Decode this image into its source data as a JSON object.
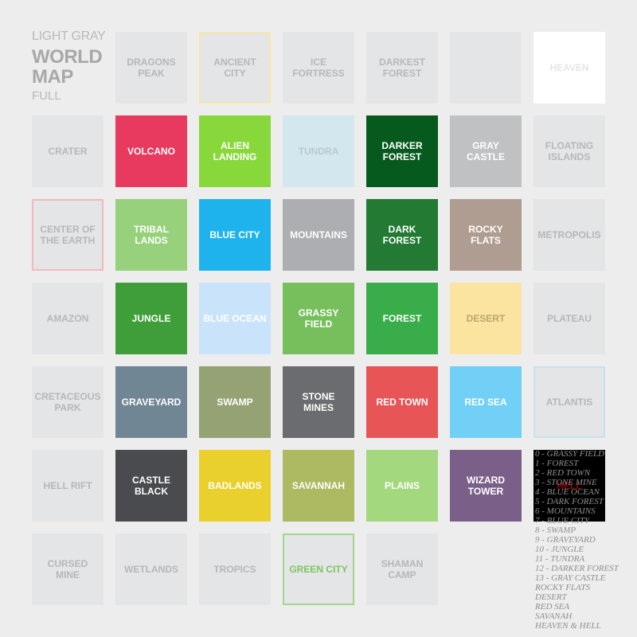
{
  "header": {
    "line1": "LIGHT GRAY",
    "line2": "WORLD",
    "line3": "MAP",
    "line4": "FULL"
  },
  "tiles": [
    {
      "label": "DRAGONS PEAK",
      "bg": "#e4e5e7",
      "fg": "#b5b7ba",
      "border": ""
    },
    {
      "label": "ANCIENT CITY",
      "bg": "#e4e5e7",
      "fg": "#b5b7ba",
      "border": "#f7e6a6"
    },
    {
      "label": "ICE FORTRESS",
      "bg": "#e4e5e7",
      "fg": "#b5b7ba",
      "border": ""
    },
    {
      "label": "DARKEST FOREST",
      "bg": "#e4e5e7",
      "fg": "#b5b7ba",
      "border": ""
    },
    {
      "label": "",
      "bg": "#e4e5e7",
      "fg": "#b5b7ba",
      "border": ""
    },
    {
      "label": "HEAVEN",
      "bg": "#ffffff",
      "fg": "#e6e6e6",
      "border": ""
    },
    {
      "label": "CRATER",
      "bg": "#e4e5e7",
      "fg": "#b5b7ba",
      "border": ""
    },
    {
      "label": "VOLCANO",
      "bg": "#e83a5f",
      "fg": "#ffffff",
      "border": ""
    },
    {
      "label": "ALIEN LANDING",
      "bg": "#88d83c",
      "fg": "#ffffff",
      "border": ""
    },
    {
      "label": "TUNDRA",
      "bg": "#d2e8ee",
      "fg": "#b8c9ce",
      "border": ""
    },
    {
      "label": "DARKER FOREST",
      "bg": "#075a1e",
      "fg": "#ffffff",
      "border": ""
    },
    {
      "label": "GRAY CASTLE",
      "bg": "#c0c1c3",
      "fg": "#ffffff",
      "border": ""
    },
    {
      "label": "FLOATING ISLANDS",
      "bg": "#e4e5e7",
      "fg": "#b5b7ba",
      "border": ""
    },
    {
      "label": "CENTER OF THE EARTH",
      "bg": "#e4e5e7",
      "fg": "#b5b7ba",
      "border": "#f2b9bc"
    },
    {
      "label": "TRIBAL LANDS",
      "bg": "#97d17c",
      "fg": "#ffffff",
      "border": ""
    },
    {
      "label": "BLUE CITY",
      "bg": "#1fb3ee",
      "fg": "#ffffff",
      "border": ""
    },
    {
      "label": "MOUNTAINS",
      "bg": "#acaeb2",
      "fg": "#ffffff",
      "border": ""
    },
    {
      "label": "DARK FOREST",
      "bg": "#227a33",
      "fg": "#ffffff",
      "border": ""
    },
    {
      "label": "ROCKY FLATS",
      "bg": "#b09d91",
      "fg": "#ffffff",
      "border": ""
    },
    {
      "label": "METROPOLIS",
      "bg": "#e4e5e7",
      "fg": "#b5b7ba",
      "border": ""
    },
    {
      "label": "AMAZON",
      "bg": "#e4e5e7",
      "fg": "#b5b7ba",
      "border": ""
    },
    {
      "label": "JUNGLE",
      "bg": "#3f9e3a",
      "fg": "#ffffff",
      "border": ""
    },
    {
      "label": "BLUE OCEAN",
      "bg": "#c9e4fa",
      "fg": "#ffffff",
      "border": ""
    },
    {
      "label": "GRASSY FIELD",
      "bg": "#76bf5c",
      "fg": "#ffffff",
      "border": ""
    },
    {
      "label": "FOREST",
      "bg": "#39ad4a",
      "fg": "#ffffff",
      "border": ""
    },
    {
      "label": "DESERT",
      "bg": "#fbe49f",
      "fg": "#b9a770",
      "border": ""
    },
    {
      "label": "PLATEAU",
      "bg": "#e4e5e7",
      "fg": "#b5b7ba",
      "border": ""
    },
    {
      "label": "CRETACEOUS PARK",
      "bg": "#e4e5e7",
      "fg": "#b5b7ba",
      "border": ""
    },
    {
      "label": "GRAVEYARD",
      "bg": "#708694",
      "fg": "#ffffff",
      "border": ""
    },
    {
      "label": "SWAMP",
      "bg": "#94a274",
      "fg": "#ffffff",
      "border": ""
    },
    {
      "label": "STONE MINES",
      "bg": "#6b6c6f",
      "fg": "#ffffff",
      "border": ""
    },
    {
      "label": "RED TOWN",
      "bg": "#e85557",
      "fg": "#ffffff",
      "border": ""
    },
    {
      "label": "RED SEA",
      "bg": "#72cff5",
      "fg": "#ffffff",
      "border": ""
    },
    {
      "label": "ATLANTIS",
      "bg": "#e4e5e7",
      "fg": "#b5b7ba",
      "border": "#c6e1f3"
    },
    {
      "label": "HELL RIFT",
      "bg": "#e4e5e7",
      "fg": "#b5b7ba",
      "border": ""
    },
    {
      "label": "CASTLE BLACK",
      "bg": "#4a4b4e",
      "fg": "#ffffff",
      "border": ""
    },
    {
      "label": "BADLANDS",
      "bg": "#e9d02c",
      "fg": "#ffffff",
      "border": ""
    },
    {
      "label": "SAVANNAH",
      "bg": "#adba62",
      "fg": "#ffffff",
      "border": ""
    },
    {
      "label": "PLAINS",
      "bg": "#a4d87f",
      "fg": "#ffffff",
      "border": ""
    },
    {
      "label": "WIZARD TOWER",
      "bg": "#7a6088",
      "fg": "#ffffff",
      "border": ""
    },
    {
      "label": "HELL",
      "bg": "#000000",
      "fg": "#8b0000",
      "border": ""
    },
    {
      "label": "CURSED MINE",
      "bg": "#e4e5e7",
      "fg": "#b5b7ba",
      "border": ""
    },
    {
      "label": "WETLANDS",
      "bg": "#e4e5e7",
      "fg": "#b5b7ba",
      "border": ""
    },
    {
      "label": "TROPICS",
      "bg": "#e4e5e7",
      "fg": "#b5b7ba",
      "border": ""
    },
    {
      "label": "GREEN CITY",
      "bg": "#e4e5e7",
      "fg": "#7dc55a",
      "border": "#a3d68c"
    },
    {
      "label": "SHAMAN CAMP",
      "bg": "#e4e5e7",
      "fg": "#b5b7ba",
      "border": ""
    }
  ],
  "legend": [
    "0 - GRASSY FIELD",
    "1 - FOREST",
    "2 - RED TOWN",
    "3 - STONE MINE",
    "4 - BLUE OCEAN",
    "5 - DARK FOREST",
    "6 - MOUNTAINS",
    "7 - BLUE CITY",
    "8 - SWAMP",
    "9 - GRAVEYARD",
    "10 - JUNGLE",
    "11 - TUNDRA",
    "12 - DARKER FOREST",
    "13 - GRAY CASTLE",
    "ROCKY FLATS",
    "DESERT",
    "RED SEA",
    "SAVANAH",
    "HEAVEN & HELL"
  ]
}
